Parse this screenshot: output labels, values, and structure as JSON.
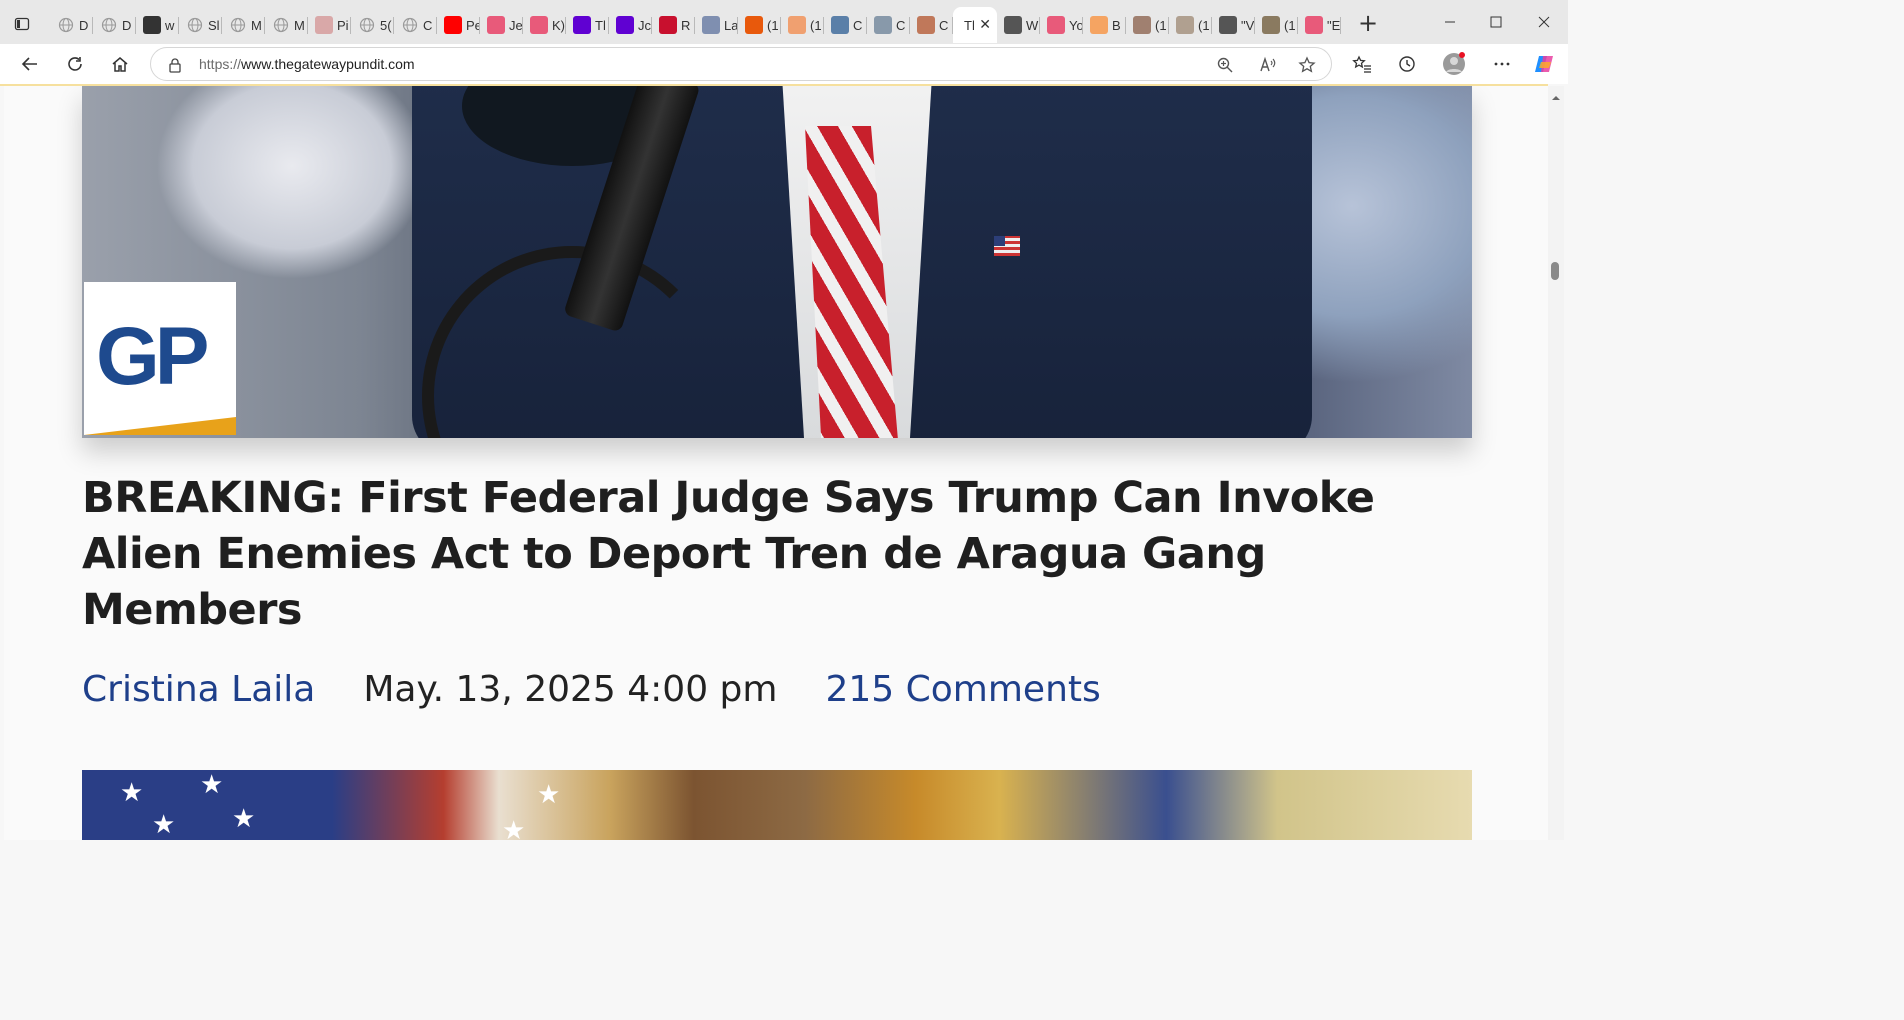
{
  "browser": {
    "tabs": [
      {
        "label": "D",
        "icon": "globe-icon",
        "color": "#9a9a9a"
      },
      {
        "label": "D",
        "icon": "globe-icon",
        "color": "#9a9a9a"
      },
      {
        "label": "w",
        "icon": "document-blocked-icon",
        "color": "#333333"
      },
      {
        "label": "Sl",
        "icon": "globe-icon",
        "color": "#9a9a9a"
      },
      {
        "label": "M",
        "icon": "globe-icon",
        "color": "#9a9a9a"
      },
      {
        "label": "M",
        "icon": "globe-icon",
        "color": "#9a9a9a"
      },
      {
        "label": "Pi",
        "icon": "pdf-icon",
        "color": "#d9a8a8"
      },
      {
        "label": "5(",
        "icon": "globe-icon",
        "color": "#9a9a9a"
      },
      {
        "label": "C",
        "icon": "globe-icon",
        "color": "#9a9a9a"
      },
      {
        "label": "Pe",
        "icon": "youtube-icon",
        "color": "#ff0000"
      },
      {
        "label": "Je",
        "icon": "youtube-icon",
        "color": "#e85a7a"
      },
      {
        "label": "K)",
        "icon": "youtube-icon",
        "color": "#e85a7a"
      },
      {
        "label": "Tl",
        "icon": "yahoo-icon",
        "color": "#6001d2"
      },
      {
        "label": "Jc",
        "icon": "yahoo-icon",
        "color": "#6001d2"
      },
      {
        "label": "R",
        "icon": "p-logo-icon",
        "color": "#c8102e"
      },
      {
        "label": "La",
        "icon": "image-thumb-icon",
        "color": "#7f8fb0"
      },
      {
        "label": "(1",
        "icon": "bookmark-orange-icon",
        "color": "#e8590c"
      },
      {
        "label": "(1",
        "icon": "bookmark-orange-icon",
        "color": "#f0a070"
      },
      {
        "label": "C",
        "icon": "image-thumb-icon",
        "color": "#5a7fa8"
      },
      {
        "label": "C",
        "icon": "seal-icon",
        "color": "#8899aa"
      },
      {
        "label": "C",
        "icon": "image-thumb-icon",
        "color": "#c0785a"
      },
      {
        "label": "Tl",
        "icon": "none",
        "color": "#ffffff",
        "active": true
      },
      {
        "label": "W",
        "icon": "diamond-icon",
        "color": "#555555"
      },
      {
        "label": "Yo",
        "icon": "youtube-icon",
        "color": "#e85a7a"
      },
      {
        "label": "B",
        "icon": "blogger-icon",
        "color": "#f5a462"
      },
      {
        "label": "(1",
        "icon": "image-thumb-icon",
        "color": "#a08070"
      },
      {
        "label": "(1",
        "icon": "image-thumb-icon",
        "color": "#b0a090"
      },
      {
        "label": "\"V",
        "icon": "r-logo-icon",
        "color": "#555555"
      },
      {
        "label": "(1",
        "icon": "image-thumb-icon",
        "color": "#8a7a60"
      },
      {
        "label": "\"E",
        "icon": "youtube-icon",
        "color": "#e85a7a"
      }
    ],
    "url_scheme": "https://",
    "url_host": "www.thegatewaypundit.com"
  },
  "article": {
    "logo_text": "GP",
    "headline": "BREAKING: First Federal Judge Says Trump Can Invoke Alien Enemies Act to Deport Tren de Aragua Gang Members",
    "author": "Cristina Laila",
    "date": "May. 13, 2025 4:00 pm",
    "comments": "215 Comments"
  },
  "colors": {
    "link_blue": "#1e3f8a",
    "logo_blue": "#1e4a8e",
    "logo_gold": "#e8a21a"
  }
}
